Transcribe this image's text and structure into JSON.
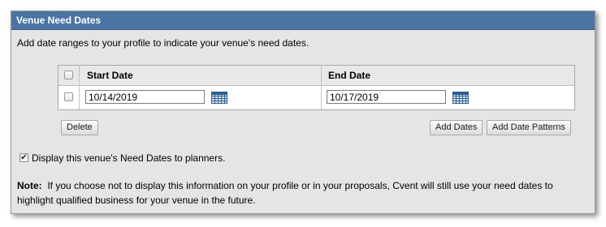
{
  "panel": {
    "title": "Venue Need Dates",
    "intro": "Add date ranges to your profile to indicate your venue's need dates."
  },
  "table": {
    "columns": [
      "Start Date",
      "End Date"
    ],
    "rows": [
      {
        "selected": false,
        "start_date": "10/14/2019",
        "end_date": "10/17/2019"
      }
    ]
  },
  "buttons": {
    "delete": "Delete",
    "add_dates": "Add Dates",
    "add_date_patterns": "Add Date Patterns"
  },
  "display_option": {
    "checked": true,
    "label": "Display this venue's Need Dates to planners."
  },
  "note": {
    "label": "Note:",
    "text": "If you choose not to display this information on your profile or in your proposals, Cvent will still use your need dates to highlight qualified business for your venue in the future."
  },
  "colors": {
    "header_bg": "#4b74a3",
    "panel_bg": "#e5e5e5",
    "calendar_icon": "#2d5d8e"
  },
  "icons": [
    "calendar-icon",
    "checkbox-icon"
  ]
}
